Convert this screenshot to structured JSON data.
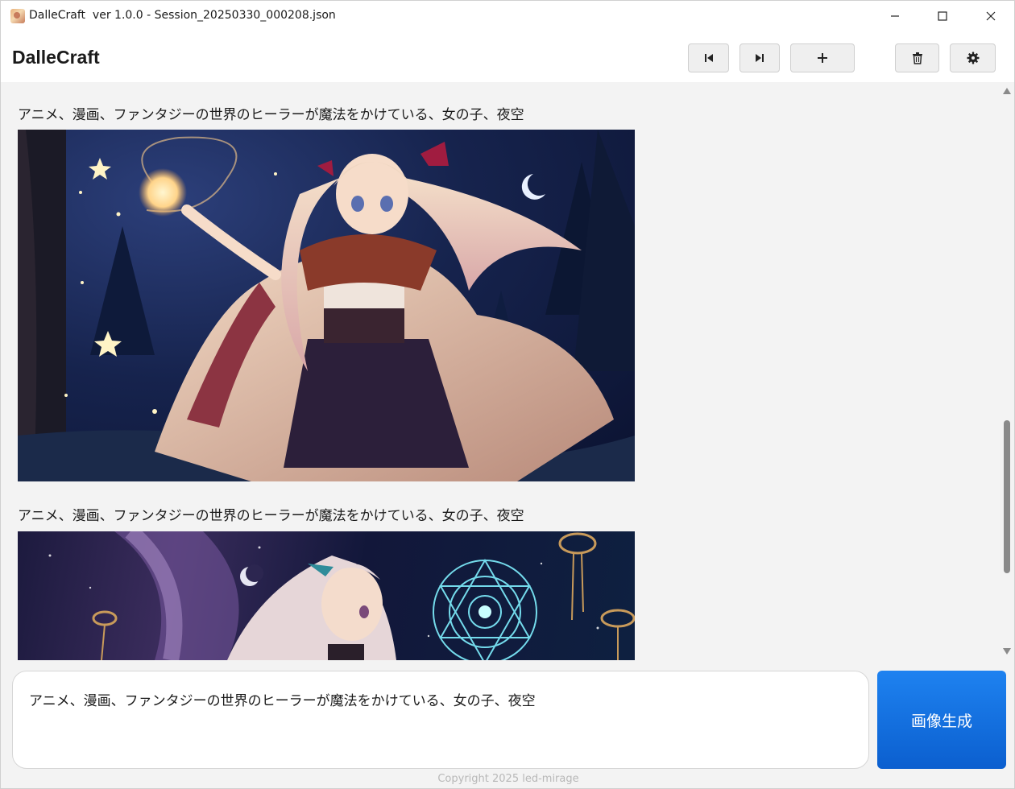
{
  "window": {
    "title": "DalleCraft  ver 1.0.0 - Session_20250330_000208.json"
  },
  "header": {
    "app_name": "DalleCraft",
    "buttons": [
      {
        "name": "previous",
        "icon": "skip-previous-icon"
      },
      {
        "name": "next",
        "icon": "skip-next-icon"
      },
      {
        "name": "add",
        "icon": "plus-icon"
      },
      {
        "name": "delete",
        "icon": "trash-icon"
      },
      {
        "name": "settings",
        "icon": "gear-icon"
      }
    ]
  },
  "history": [
    {
      "prompt": "アニメ、漫画、ファンタジーの世界のヒーラーが魔法をかけている、女の子、夜空",
      "image": "generated-image-healer-girl-casting-magic"
    },
    {
      "prompt": "アニメ、漫画、ファンタジーの世界のヒーラーが魔法をかけている、女の子、夜空",
      "image": "generated-image-girl-magic-circle"
    }
  ],
  "input": {
    "value": "アニメ、漫画、ファンタジーの世界のヒーラーが魔法をかけている、女の子、夜空",
    "generate_label": "画像生成"
  },
  "footer": {
    "copyright": "Copyright 2025 led-mirage"
  },
  "colors": {
    "accent": "#0b6fe0",
    "content_bg": "#f3f3f3"
  }
}
